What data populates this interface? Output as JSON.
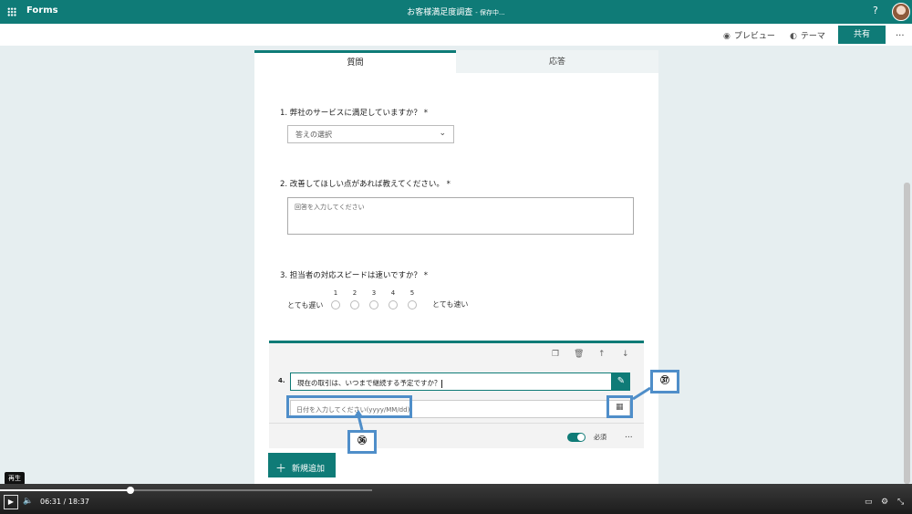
{
  "header": {
    "app_name": "Forms",
    "form_title": "お客様満足度調査",
    "save_status": "- 保存中...",
    "help_label": "?"
  },
  "toolbar": {
    "preview_label": "プレビュー",
    "theme_label": "テーマ",
    "share_label": "共有",
    "more_label": "..."
  },
  "tabs": {
    "questions_label": "質問",
    "responses_label": "応答"
  },
  "questions": {
    "q1_title": "1. 弊社のサービスに満足していますか？ *",
    "q1_dropdown": "答えの選択",
    "q2_title": "2. 改善してほしい点があれば教えてください。 *",
    "q2_placeholder": "回答を入力してください",
    "q3_title": "3. 担当者の対応スピードは速いですか？ *",
    "q3_low_label": "とても遅い",
    "q3_high_label": "とても速い",
    "q3_scale": [
      "1",
      "2",
      "3",
      "4",
      "5"
    ],
    "q4_number": "4.",
    "q4_text": "現在の取引は、いつまで継続する予定ですか？",
    "q4_date_placeholder": "日付を入力してください(yyyy/MM/dd)",
    "q4_required_label": "必須",
    "q4_more": "..."
  },
  "add_new_label": "新規追加",
  "callouts": {
    "c36": "㊱",
    "c37": "㊲"
  },
  "player": {
    "tooltip": "再生",
    "current_time": "06:31",
    "separator": "/",
    "total_time": "18:37",
    "progress_fraction": 0.35
  },
  "colors": {
    "brand": "#0f7b77",
    "callout": "#4f8ec9"
  }
}
